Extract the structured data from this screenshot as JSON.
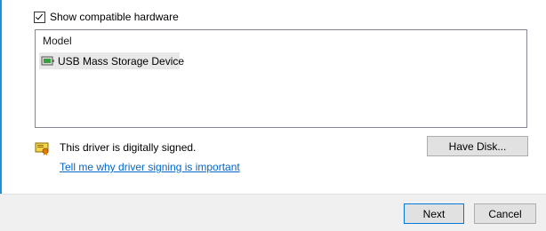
{
  "compatible_hardware": {
    "label": "Show compatible hardware",
    "checked": true
  },
  "model_list": {
    "header": "Model",
    "items": [
      {
        "label": "USB Mass Storage Device",
        "icon": "usb-device-icon",
        "selected": true
      }
    ]
  },
  "signing": {
    "status_text": "This driver is digitally signed.",
    "status_icon": "signed-driver-icon",
    "link_text": "Tell me why driver signing is important"
  },
  "buttons": {
    "have_disk": "Have Disk...",
    "next": "Next",
    "cancel": "Cancel"
  },
  "colors": {
    "link": "#0066cc",
    "accent": "#1e90d6",
    "default_button_border": "#0078d7"
  }
}
